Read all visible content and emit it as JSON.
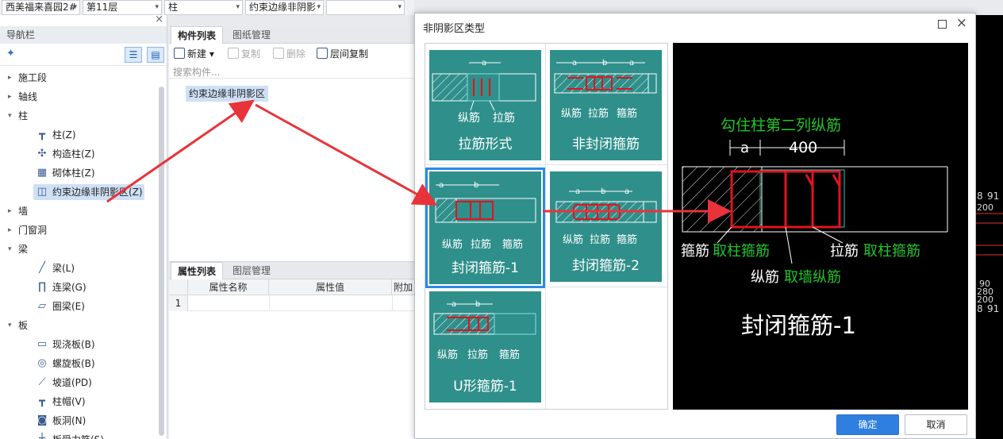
{
  "topbar": {
    "project": "西美福来喜园2#",
    "floor": "第11层",
    "category": "柱",
    "component_type": "约束边缘非阴影",
    "empty": ""
  },
  "nav": {
    "title": "导航栏",
    "items": [
      {
        "label": "施工段",
        "type": "parent",
        "expanded": false
      },
      {
        "label": "轴线",
        "type": "parent",
        "expanded": false
      },
      {
        "label": "柱",
        "type": "parent",
        "expanded": true
      },
      {
        "label": "柱(Z)",
        "type": "child",
        "icon": "column-icon"
      },
      {
        "label": "构造柱(Z)",
        "type": "child",
        "icon": "structural-column-icon"
      },
      {
        "label": "砌体柱(Z)",
        "type": "child",
        "icon": "masonry-column-icon"
      },
      {
        "label": "约束边缘非阴影区(Z)",
        "type": "child",
        "icon": "boundary-zone-icon",
        "selected": true
      },
      {
        "label": "墙",
        "type": "parent",
        "expanded": false
      },
      {
        "label": "门窗洞",
        "type": "parent",
        "expanded": false
      },
      {
        "label": "梁",
        "type": "parent",
        "expanded": true
      },
      {
        "label": "梁(L)",
        "type": "child",
        "icon": "beam-icon"
      },
      {
        "label": "连梁(G)",
        "type": "child",
        "icon": "coupling-beam-icon"
      },
      {
        "label": "圈梁(E)",
        "type": "child",
        "icon": "ring-beam-icon"
      },
      {
        "label": "板",
        "type": "parent",
        "expanded": true
      },
      {
        "label": "现浇板(B)",
        "type": "child",
        "icon": "cast-slab-icon"
      },
      {
        "label": "螺旋板(B)",
        "type": "child",
        "icon": "spiral-slab-icon"
      },
      {
        "label": "坡道(PD)",
        "type": "child",
        "icon": "ramp-icon"
      },
      {
        "label": "柱帽(V)",
        "type": "child",
        "icon": "column-cap-icon"
      },
      {
        "label": "板洞(N)",
        "type": "child",
        "icon": "slab-hole-icon"
      },
      {
        "label": "板受力筋(S)",
        "type": "child",
        "icon": "slab-rebar-icon"
      }
    ]
  },
  "component_panel": {
    "tabs": [
      "构件列表",
      "图纸管理"
    ],
    "toolbar": {
      "new": "新建",
      "copy": "复制",
      "delete": "删除",
      "floor_copy": "层间复制"
    },
    "search_placeholder": "搜索构件...",
    "component": "约束边缘非阴影区"
  },
  "property_panel": {
    "tabs": [
      "属性列表",
      "图层管理"
    ],
    "columns": [
      "属性名称",
      "属性值",
      "附加"
    ],
    "row_number": "1"
  },
  "dialog": {
    "title": "非阴影区类型",
    "tiles": [
      {
        "label": "拉筋形式",
        "annotations": [
          "纵筋",
          "拉筋"
        ],
        "dims": [
          "a"
        ]
      },
      {
        "label": "非封闭箍筋",
        "annotations": [
          "纵筋",
          "拉筋",
          "箍筋"
        ],
        "dims": [
          "a",
          "b",
          "a"
        ]
      },
      {
        "label": "封闭箍筋-1",
        "annotations": [
          "纵筋",
          "拉筋",
          "箍筋"
        ],
        "dims": [
          "a",
          "b"
        ],
        "selected": true
      },
      {
        "label": "封闭箍筋-2",
        "annotations": [
          "纵筋",
          "拉筋",
          "箍筋"
        ],
        "dims": [
          "a",
          "b",
          "a"
        ]
      },
      {
        "label": "U形箍筋-1",
        "annotations": [
          "纵筋",
          "拉筋",
          "箍筋"
        ],
        "dims": [
          "a",
          "b"
        ]
      }
    ],
    "preview": {
      "top_note": "勾住柱第二列纵筋",
      "dim_a": "a",
      "dim_value": "400",
      "stirrup": "箍筋",
      "stirrup_rule": "取柱箍筋",
      "tie": "拉筋",
      "tie_rule": "取柱箍筋",
      "longitudinal": "纵筋",
      "longitudinal_rule": "取墙纵筋",
      "caption": "封闭箍筋-1"
    },
    "ok": "确定",
    "cancel": "取消"
  },
  "colors": {
    "tile_bg": "#2f8f8b",
    "rebar_red": "#e0141e",
    "note_green": "#22c42a",
    "arrow_red": "#e8333b",
    "accent_blue": "#2f7fe0"
  },
  "cad_strip": {
    "labels": [
      "8",
      "91",
      "200",
      "90",
      "280",
      "200",
      "8",
      "91"
    ]
  }
}
